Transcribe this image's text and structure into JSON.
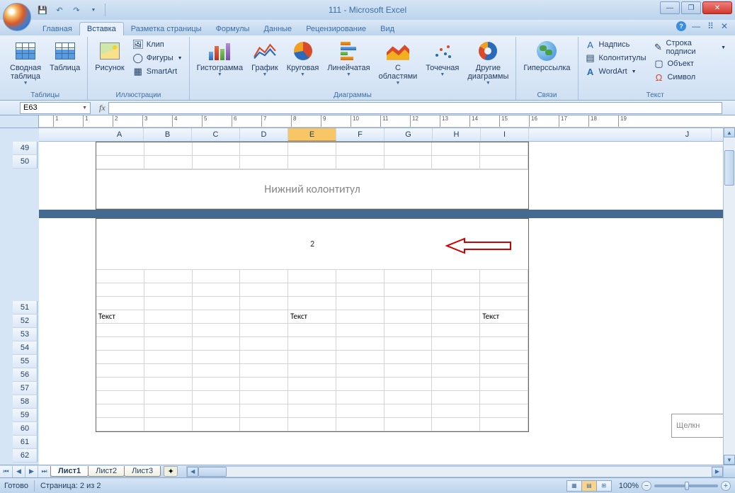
{
  "title": "111 - Microsoft Excel",
  "tabs": [
    "Главная",
    "Вставка",
    "Разметка страницы",
    "Формулы",
    "Данные",
    "Рецензирование",
    "Вид"
  ],
  "activeTab": 1,
  "ribbon": {
    "groups": [
      {
        "label": "Таблицы",
        "items": [
          {
            "label": "Сводная\nтаблица"
          },
          {
            "label": "Таблица"
          }
        ]
      },
      {
        "label": "Иллюстрации",
        "big": {
          "label": "Рисунок"
        },
        "small": [
          {
            "label": "Клип"
          },
          {
            "label": "Фигуры"
          },
          {
            "label": "SmartArt"
          }
        ]
      },
      {
        "label": "Диаграммы",
        "items": [
          {
            "label": "Гистограмма"
          },
          {
            "label": "График"
          },
          {
            "label": "Круговая"
          },
          {
            "label": "Линейчатая"
          },
          {
            "label": "С\nобластями"
          },
          {
            "label": "Точечная"
          },
          {
            "label": "Другие\nдиаграммы"
          }
        ]
      },
      {
        "label": "Связи",
        "items": [
          {
            "label": "Гиперссылка"
          }
        ]
      },
      {
        "label": "Текст",
        "small": [
          {
            "label": "Надпись"
          },
          {
            "label": "Колонтитулы"
          },
          {
            "label": "WordArt"
          },
          {
            "label": "Строка подписи"
          },
          {
            "label": "Объект"
          },
          {
            "label": "Символ"
          }
        ]
      }
    ]
  },
  "namebox": "E63",
  "ruler_marks": [
    "1",
    "1",
    "2",
    "3",
    "4",
    "5",
    "6",
    "7",
    "8",
    "9",
    "10",
    "11",
    "12",
    "13",
    "14",
    "15",
    "16",
    "17",
    "18",
    "19"
  ],
  "columns": [
    "A",
    "B",
    "C",
    "D",
    "E",
    "F",
    "G",
    "H",
    "I"
  ],
  "col_far": "J",
  "selected_col": "E",
  "rows_top": [
    "49",
    "50"
  ],
  "rows_bottom": [
    "51",
    "52",
    "53",
    "54",
    "55",
    "56",
    "57",
    "58",
    "59",
    "60",
    "61",
    "62"
  ],
  "footer_label": "Нижний колонтитул",
  "page_number": "2",
  "cell_text": "Текст",
  "right_panel": "Щелкн",
  "sheets": [
    "Лист1",
    "Лист2",
    "Лист3"
  ],
  "active_sheet": 0,
  "status": {
    "ready": "Готово",
    "page": "Страница: 2 из 2",
    "zoom": "100%"
  }
}
